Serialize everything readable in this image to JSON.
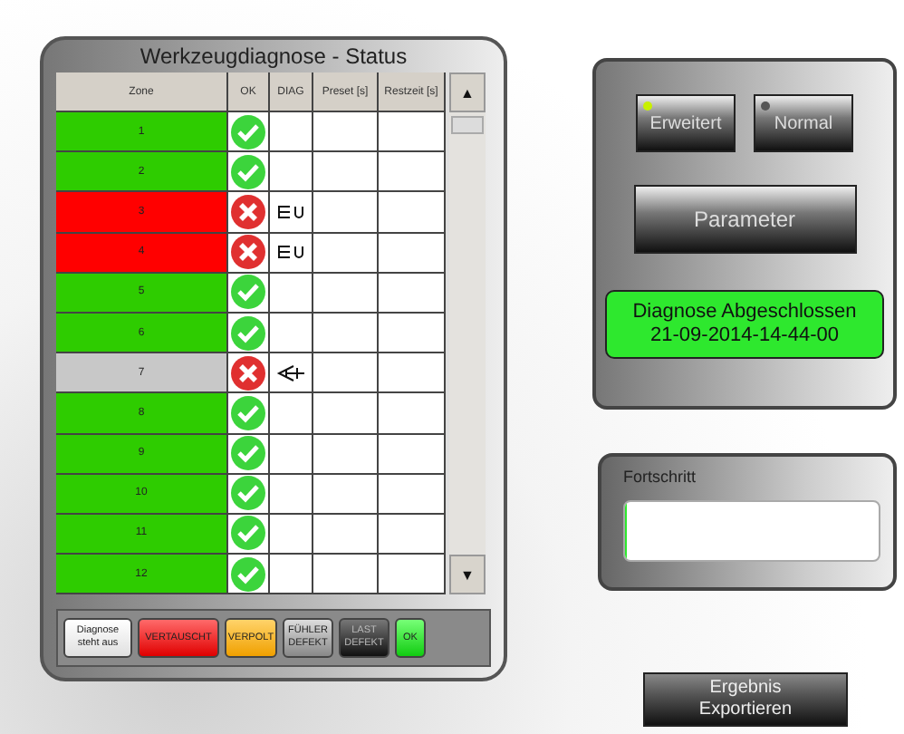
{
  "panel_title": "Werkzeugdiagnose - Status",
  "table": {
    "columns": [
      "Zone",
      "OK",
      "DIAG",
      "Preset [s]",
      "Restzeit [s]"
    ],
    "rows": [
      {
        "zone": "1",
        "color": "#2ecc00",
        "ok": true,
        "kind": "plain"
      },
      {
        "zone": "2",
        "color": "#2ecc00",
        "ok": true,
        "kind": "plain"
      },
      {
        "zone": "3",
        "color": "#ff0000",
        "ok": false,
        "kind": "plug"
      },
      {
        "zone": "4",
        "color": "#ff0000",
        "ok": false,
        "kind": "plug"
      },
      {
        "zone": "5",
        "color": "#2ecc00",
        "ok": true,
        "kind": "plain"
      },
      {
        "zone": "6",
        "color": "#2ecc00",
        "ok": true,
        "kind": "plain"
      },
      {
        "zone": "7",
        "color": "#c8c8c8",
        "ok": false,
        "kind": "probe"
      },
      {
        "zone": "8",
        "color": "#2ecc00",
        "ok": true,
        "kind": "plain"
      },
      {
        "zone": "9",
        "color": "#2ecc00",
        "ok": true,
        "kind": "plain"
      },
      {
        "zone": "10",
        "color": "#2ecc00",
        "ok": true,
        "kind": "plain"
      },
      {
        "zone": "11",
        "color": "#2ecc00",
        "ok": true,
        "kind": "plain"
      },
      {
        "zone": "12",
        "color": "#2ecc00",
        "ok": true,
        "kind": "plain"
      }
    ]
  },
  "scroll": {
    "up": "▲",
    "down": "▼"
  },
  "legend": [
    {
      "kind": "white",
      "label": "Diagnose steht aus"
    },
    {
      "kind": "red",
      "label": "VERTAUSCHT"
    },
    {
      "kind": "orange",
      "label": "VERPOLT"
    },
    {
      "kind": "grey",
      "label": "FÜHLER DEFEKT"
    },
    {
      "kind": "black",
      "label": "LAST DEFEKT"
    },
    {
      "kind": "green",
      "label": "OK"
    }
  ],
  "modes": [
    {
      "label": "Erweitert",
      "selected": true
    },
    {
      "label": "Normal",
      "selected": false
    }
  ],
  "parameter_button": "Parameter",
  "status": [
    "Diagnose Abgeschlossen",
    "21-09-2014-14-44-00"
  ],
  "progress": {
    "label": "Fortschritt",
    "level": 0.01
  },
  "export_button": [
    "Ergebnis",
    "Exportieren"
  ]
}
